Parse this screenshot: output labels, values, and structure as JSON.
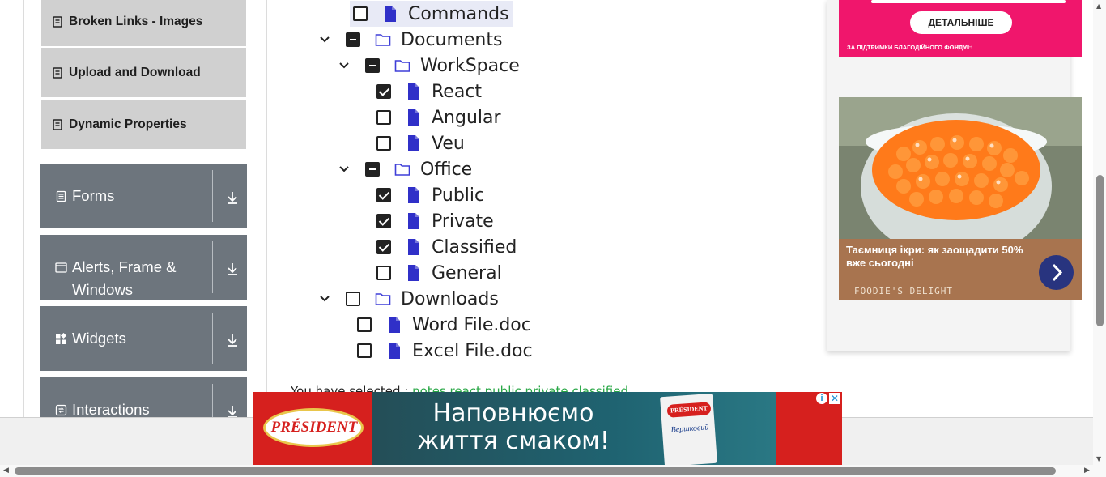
{
  "sidebar": {
    "subitems": [
      {
        "label": "Broken Links - Images",
        "icon": "document-icon"
      },
      {
        "label": "Upload and Download",
        "icon": "document-icon"
      },
      {
        "label": "Dynamic Properties",
        "icon": "document-icon"
      }
    ],
    "groups": [
      {
        "label_lines": [
          "Forms"
        ],
        "icon": "form-icon"
      },
      {
        "label_lines": [
          "Alerts, Frame &",
          "Windows"
        ],
        "icon": "window-icon"
      },
      {
        "label_lines": [
          "Widgets"
        ],
        "icon": "widgets-icon"
      },
      {
        "label_lines": [
          "Interactions"
        ],
        "icon": "interactions-icon"
      }
    ]
  },
  "tree": {
    "nodes": [
      {
        "name": "commands",
        "label": "Commands",
        "type": "file",
        "state": "unchecked",
        "expanded": null,
        "highlighted": true
      },
      {
        "name": "documents",
        "label": "Documents",
        "type": "folder",
        "state": "half",
        "expanded": true
      },
      {
        "name": "workspace",
        "label": "WorkSpace",
        "type": "folder",
        "state": "half",
        "expanded": true
      },
      {
        "name": "react",
        "label": "React",
        "type": "file",
        "state": "checked"
      },
      {
        "name": "angular",
        "label": "Angular",
        "type": "file",
        "state": "unchecked"
      },
      {
        "name": "veu",
        "label": "Veu",
        "type": "file",
        "state": "unchecked"
      },
      {
        "name": "office",
        "label": "Office",
        "type": "folder",
        "state": "half",
        "expanded": true
      },
      {
        "name": "public",
        "label": "Public",
        "type": "file",
        "state": "checked"
      },
      {
        "name": "private",
        "label": "Private",
        "type": "file",
        "state": "checked"
      },
      {
        "name": "classified",
        "label": "Classified",
        "type": "file",
        "state": "checked"
      },
      {
        "name": "general",
        "label": "General",
        "type": "file",
        "state": "unchecked"
      },
      {
        "name": "downloads",
        "label": "Downloads",
        "type": "folder",
        "state": "unchecked",
        "expanded": true
      },
      {
        "name": "word-file",
        "label": "Word File.doc",
        "type": "file",
        "state": "unchecked"
      },
      {
        "name": "excel-file",
        "label": "Excel File.doc",
        "type": "file",
        "state": "unchecked"
      }
    ],
    "selected_label": "You have selected :",
    "selected_values": "notes react public private classified"
  },
  "ads": {
    "pink": {
      "button": "ДЕТАЛЬНІШЕ",
      "footer": "ЗА ПІДТРИМКИ БЛАГОДІЙНОГО ФОНДУ",
      "footer_logos": "UA  МН"
    },
    "caviar": {
      "headline": "Таємниця ікри: як заощадити 50% вже сьогодні",
      "brand": "FOODIE'S DELIGHT"
    },
    "banner": {
      "logo": "PRÉSIDENT",
      "slogan_line1": "Наповнюємо",
      "slogan_line2": "життя смаком!",
      "pack_logo": "PRÉSIDENT",
      "pack_text": "Вершковий",
      "info": "i",
      "close": "✕"
    }
  },
  "colors": {
    "group_bg": "#6d757d",
    "subitem_bg": "#d0d0d0",
    "folder_icon": "#3f3fd8",
    "file_icon": "#3030c8",
    "selected_green": "#28a745",
    "ad_pink": "#f0166c"
  }
}
